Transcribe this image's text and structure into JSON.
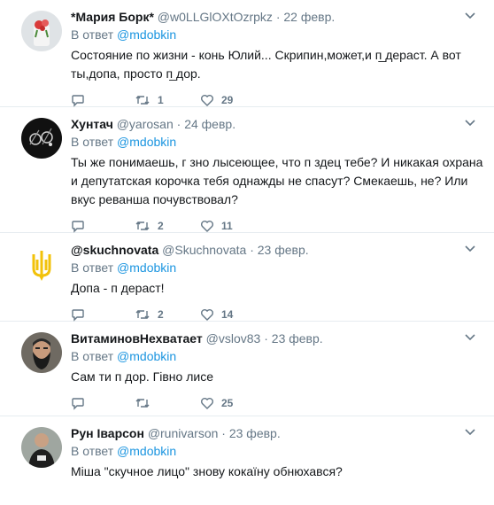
{
  "tweets": [
    {
      "name": "*Мария Борк*",
      "handle": "@w0LLGlOXtOzrpkz",
      "date": "22 февр.",
      "reply_prefix": "В ответ",
      "reply_to": "@mdobkin",
      "text": "Состояние по жизни - конь Юлий... Скрипин,может,и п̲ дераст.  А вот ты,допа, просто п̲ дор.",
      "retweets": "1",
      "likes": "29",
      "avatar": "flower-photo"
    },
    {
      "name": "Хунтач",
      "handle": "@yarosan",
      "date": "24 февр.",
      "reply_prefix": "В ответ",
      "reply_to": "@mdobkin",
      "text": "Ты же понимаешь, г  зно лысеющее, что п  здец тебе? И никакая охрана и депутатская корочка тебя однажды не спасут? Смекаешь, не? Или вкус реванша почувствовал?",
      "retweets": "2",
      "likes": "11",
      "avatar": "dark-photo"
    },
    {
      "name": "@skuchnovata",
      "handle": "@Skuchnovata",
      "date": "23 февр.",
      "reply_prefix": "В ответ",
      "reply_to": "@mdobkin",
      "text": "Допа - п  дераст!",
      "retweets": "2",
      "likes": "14",
      "avatar": "trident-emblem"
    },
    {
      "name": "ВитаминовНехватает",
      "handle": "@vslov83",
      "date": "23 февр.",
      "reply_prefix": "В ответ",
      "reply_to": "@mdobkin",
      "text": "Сам ти п  дор. Гівно лисе",
      "retweets": "",
      "likes": "25",
      "avatar": "bearded-man-photo"
    },
    {
      "name": "Рун Іварсон",
      "handle": "@runivarson",
      "date": "23 февр.",
      "reply_prefix": "В ответ",
      "reply_to": "@mdobkin",
      "text": "Міша \"скучное лицо\" знову кокаїну обнюхався?",
      "retweets": "",
      "likes": "",
      "avatar": "man-tshirt-photo"
    }
  ],
  "colors": {
    "link": "#1b95e0",
    "muted": "#657786",
    "divider": "#e6ecf0",
    "trident": "#f2c20a"
  }
}
